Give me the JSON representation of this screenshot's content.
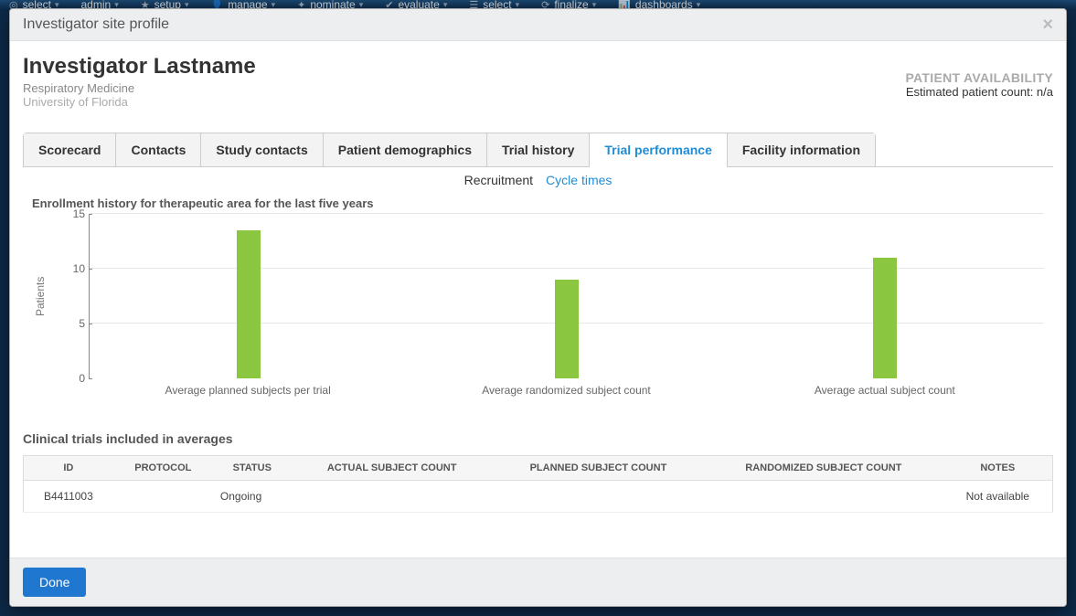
{
  "bg_nav": {
    "items": [
      {
        "label": "select",
        "glyph": "◎"
      },
      {
        "label": "admin",
        "glyph": ""
      },
      {
        "label": "setup",
        "glyph": "★"
      },
      {
        "label": "manage",
        "glyph": "👤"
      },
      {
        "label": "nominate",
        "glyph": "✦"
      },
      {
        "label": "evaluate",
        "glyph": "✔"
      },
      {
        "label": "select",
        "glyph": "☰"
      },
      {
        "label": "finalize",
        "glyph": "⟳"
      },
      {
        "label": "dashboards",
        "glyph": "📊"
      }
    ]
  },
  "modal": {
    "title": "Investigator site profile",
    "close_glyph": "×",
    "done_label": "Done"
  },
  "profile": {
    "name": "Investigator Lastname",
    "department": "Respiratory Medicine",
    "institution": "University of Florida",
    "availability_title": "PATIENT AVAILABILITY",
    "availability_sub": "Estimated patient count: n/a"
  },
  "tabs": {
    "items": [
      "Scorecard",
      "Contacts",
      "Study contacts",
      "Patient demographics",
      "Trial history",
      "Trial performance",
      "Facility information"
    ],
    "active_index": 5
  },
  "subtabs": {
    "recruitment": "Recruitment",
    "cycle_times": "Cycle times"
  },
  "chart_data": {
    "type": "bar",
    "title": "Enrollment history for therapeutic area for the last five years",
    "ylabel": "Patients",
    "y_ticks": [
      0,
      5,
      10,
      15
    ],
    "ylim": [
      0,
      15
    ],
    "categories": [
      "Average planned subjects per trial",
      "Average randomized subject count",
      "Average actual subject count"
    ],
    "values": [
      13.5,
      9,
      11
    ],
    "bar_color": "#8bc640"
  },
  "trials_section": {
    "title": "Clinical trials included in averages",
    "columns": [
      "ID",
      "PROTOCOL",
      "STATUS",
      "ACTUAL SUBJECT COUNT",
      "PLANNED SUBJECT COUNT",
      "RANDOMIZED SUBJECT COUNT",
      "NOTES"
    ],
    "rows": [
      {
        "id": "B4411003",
        "protocol": "",
        "status": "Ongoing",
        "actual": "",
        "planned": "",
        "randomized": "",
        "notes": "Not available"
      }
    ]
  }
}
